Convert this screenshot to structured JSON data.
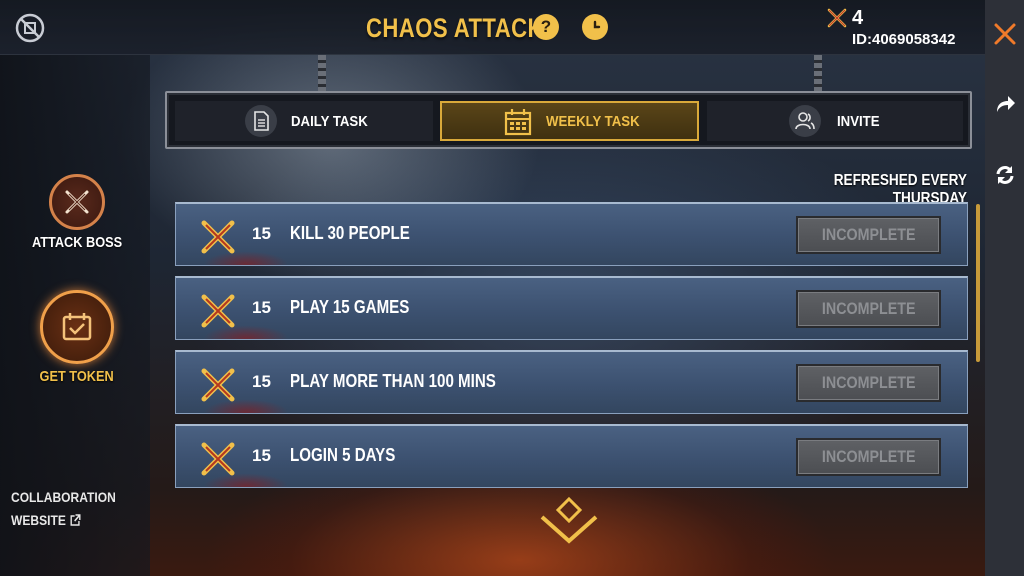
{
  "header": {
    "title": "CHAOS ATTACK",
    "help_label": "?",
    "token_count": "4",
    "player_id": "ID:4069058342"
  },
  "sidebar": {
    "items": [
      {
        "label": "ATTACK BOSS",
        "icon": "crossed-swords-icon",
        "active": false
      },
      {
        "label": "GET TOKEN",
        "icon": "calendar-check-icon",
        "active": true
      }
    ],
    "collab_line1": "COLLABORATION",
    "collab_line2": "WEBSITE"
  },
  "tabs": [
    {
      "label": "DAILY TASK",
      "icon": "document-icon",
      "active": false
    },
    {
      "label": "WEEKLY TASK",
      "icon": "calendar-icon",
      "active": true
    },
    {
      "label": "INVITE",
      "icon": "users-icon",
      "active": false
    }
  ],
  "refresh_note": "REFRESHED EVERY THURSDAY",
  "tasks": [
    {
      "reward": "15",
      "name": "KILL 30 PEOPLE",
      "status": "INCOMPLETE"
    },
    {
      "reward": "15",
      "name": "PLAY 15 GAMES",
      "status": "INCOMPLETE"
    },
    {
      "reward": "15",
      "name": "PLAY MORE THAN 100 MINS",
      "status": "INCOMPLETE"
    },
    {
      "reward": "15",
      "name": "LOGIN 5 DAYS",
      "status": "INCOMPLETE"
    }
  ],
  "colors": {
    "accent_gold": "#f1c04a",
    "close_orange": "#f07a2a",
    "task_blue": "#3c5170",
    "button_gray": "#5f6165"
  }
}
